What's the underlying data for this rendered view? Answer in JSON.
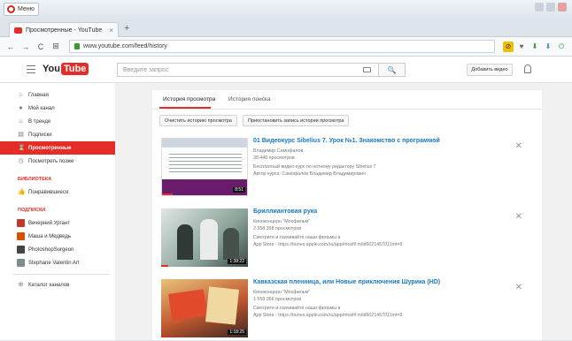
{
  "browser": {
    "menu_label": "Меню",
    "tab_title": "Просмотренные - YouTube",
    "tab_close": "×",
    "new_tab": "+",
    "url": "www.youtube.com/feed/history",
    "nav": {
      "back": "←",
      "forward": "→",
      "reload": "C",
      "home": "⊞"
    }
  },
  "youtube": {
    "logo": {
      "you": "You",
      "tube": "Tube"
    },
    "search_placeholder": "Введите запрос",
    "search_button": "🔍",
    "upload_button": "Добавить видео"
  },
  "sidebar": {
    "main_items": [
      {
        "label": "Главная",
        "icon": "⌂"
      },
      {
        "label": "Мой канал",
        "icon": "●"
      },
      {
        "label": "В тренде",
        "icon": "♨"
      },
      {
        "label": "Подписки",
        "icon": "▤"
      },
      {
        "label": "Просмотренные",
        "icon": "⌛",
        "active": true
      },
      {
        "label": "Посмотреть позже",
        "icon": "◷"
      }
    ],
    "library_heading": "БИБЛИОТЕКА",
    "library_items": [
      {
        "label": "Понравившиеся",
        "icon": "👍"
      }
    ],
    "subs_heading": "ПОДПИСКИ",
    "subs_items": [
      {
        "label": "Вечерний Ургант",
        "color": "#c0392b"
      },
      {
        "label": "Маша и Медведь",
        "color": "#d35400"
      },
      {
        "label": "PhotoshopSurgeon",
        "color": "#444444"
      },
      {
        "label": "Stephane Valentin Art",
        "color": "#7f8c8d"
      }
    ],
    "catalog": {
      "label": "Каталог каналов",
      "icon": "⊕"
    }
  },
  "content": {
    "tabs": [
      "История просмотра",
      "История поиска"
    ],
    "buttons": [
      "Очистить историю просмотра",
      "Приостановить запись истории просмотра"
    ],
    "videos": [
      {
        "title": "01 Видеокурс Sibelius 7. Урок №1. Знакомство с программой",
        "channel": "Владимир Самофалов",
        "views": "38 440 просмотров",
        "desc1": "Бесплатный видео-курс по нотному редактору Sibelius 7",
        "desc2": "Автор курса: Самофалов Владимир Владимирович",
        "duration": "8:51",
        "progress": 0.12
      },
      {
        "title": "Бриллиантовая рука",
        "channel": "Киноконцерн \"Мосфильм\"",
        "views": "2 358 398 просмотров",
        "desc1": "Смотрите и скачивайте наши фильмы в",
        "desc2": "App Store - https://itunes.apple.com/ru/app/mosfil m/id6021457011mt=8",
        "duration": "1:38:22",
        "progress": 0.08
      },
      {
        "title": "Кавказская пленница, или Новые приключения Шурика (HD)",
        "channel": "Киноконцерн \"Мосфильм\"",
        "views": "1 558 056 просмотров",
        "desc1": "Смотрите и скачивайте наши фильмы в",
        "desc2": "App Store - https://itunes.apple.com/ru/app/mosfil m/id6021457011mt=8",
        "duration": "1:18:25",
        "progress": 0.06
      }
    ]
  },
  "colors": {
    "brand": "#e52d27",
    "link": "#167ac6"
  }
}
